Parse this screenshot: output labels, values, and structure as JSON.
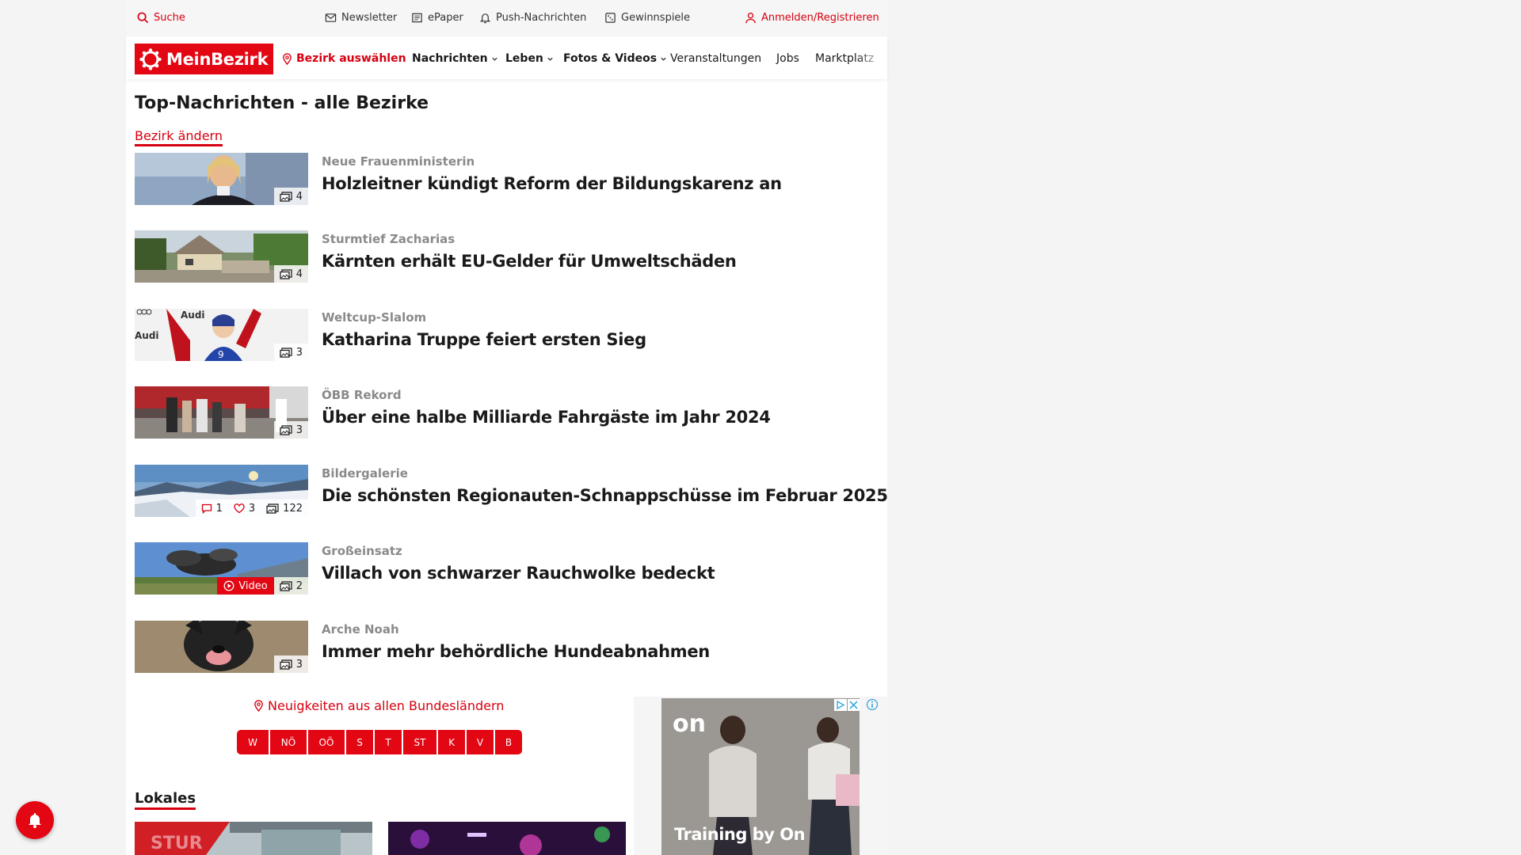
{
  "utility": {
    "search": "Suche",
    "newsletter": "Newsletter",
    "epaper": "ePaper",
    "push": "Push-Nachrichten",
    "gewinnspiele": "Gewinnspiele",
    "login": "Anmelden/Registrieren"
  },
  "nav": {
    "logo": "MeinBezirk",
    "bezirk": "Bezirk auswählen",
    "nachrichten": "Nachrichten",
    "leben": "Leben",
    "fotos": "Fotos & Videos",
    "veranstaltungen": "Veranstaltungen",
    "jobs": "Jobs",
    "marktplatz": "Marktplatz"
  },
  "heading": "Top-Nachrichten - alle Bezirke",
  "bezirk_aendern": "Bezirk ändern",
  "articles": [
    {
      "kicker": "Neue Frauenministerin",
      "title": "Holzleitner kündigt Reform der Bildungskarenz an",
      "photos": "4"
    },
    {
      "kicker": "Sturmtief Zacharias",
      "title": "Kärnten erhält EU-Gelder für Umweltschäden",
      "photos": "4"
    },
    {
      "kicker": "Weltcup-Slalom",
      "title": "Katharina Truppe feiert ersten Sieg",
      "photos": "3"
    },
    {
      "kicker": "ÖBB Rekord",
      "title": "Über eine halbe Milliarde Fahrgäste im Jahr 2024",
      "photos": "3"
    },
    {
      "kicker": "Bildergalerie",
      "title": "Die schönsten Regionauten-Schnappschüsse im Februar 2025",
      "photos": "122",
      "comments": "1",
      "likes": "3"
    },
    {
      "kicker": "Großeinsatz",
      "title": "Villach von schwarzer Rauchwolke bedeckt",
      "photos": "2",
      "video": "Video"
    },
    {
      "kicker": "Arche Noah",
      "title": "Immer mehr behördliche Hundeabnahmen",
      "photos": "3"
    }
  ],
  "bundeslaender": {
    "heading": "Neuigkeiten aus allen Bundesländern",
    "items": [
      "W",
      "NÖ",
      "OÖ",
      "S",
      "T",
      "ST",
      "K",
      "V",
      "B"
    ]
  },
  "lokales": "Lokales",
  "ad": {
    "brand": "On",
    "title": "Training by On"
  },
  "colors": {
    "brand_red": "#e30613",
    "link_red": "#d7000f",
    "kicker_gray": "#8a8a8a"
  }
}
